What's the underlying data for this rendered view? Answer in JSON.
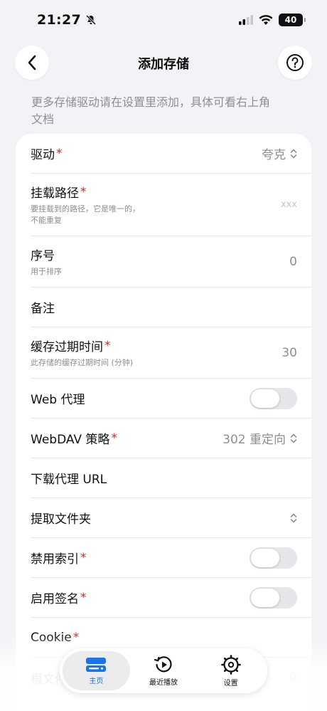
{
  "status": {
    "time": "21:27",
    "battery": "40"
  },
  "nav": {
    "title": "添加存储",
    "back_icon": "chevron-left-icon",
    "help_icon": "question-circle-icon"
  },
  "hint": "更多存储驱动请在设置里添加，具体可看右上角文档",
  "form": {
    "driver": {
      "label": "驱动",
      "value": "夸克"
    },
    "mount_path": {
      "label": "挂载路径",
      "desc_line1": "要挂载到的路径，它是唯一的，",
      "desc_line2": "不能重复",
      "placeholder": "xxx"
    },
    "order": {
      "label": "序号",
      "desc": "用于排序",
      "value": "0"
    },
    "remark": {
      "label": "备注"
    },
    "cache": {
      "label": "缓存过期时间",
      "desc": "此存储的缓存过期时间 (分钟)",
      "value": "30"
    },
    "web_proxy": {
      "label": "Web 代理",
      "enabled": false
    },
    "webdav": {
      "label": "WebDAV 策略",
      "value": "302 重定向"
    },
    "download_proxy": {
      "label": "下载代理 URL"
    },
    "extract_folder": {
      "label": "提取文件夹"
    },
    "disable_index": {
      "label": "禁用索引",
      "enabled": false
    },
    "enable_sign": {
      "label": "启用签名",
      "enabled": false
    },
    "cookie": {
      "label": "Cookie"
    },
    "root_folder": {
      "label": "根文件夹",
      "value": "0"
    },
    "required_mark": "*"
  },
  "tabs": [
    {
      "label": "主页",
      "icon": "storage-icon",
      "active": true
    },
    {
      "label": "最近播放",
      "icon": "history-play-icon",
      "active": false
    },
    {
      "label": "设置",
      "icon": "gear-icon",
      "active": false
    }
  ],
  "colors": {
    "accent": "#1a73e8",
    "required": "#e02424",
    "background": "#f2f2f7"
  }
}
